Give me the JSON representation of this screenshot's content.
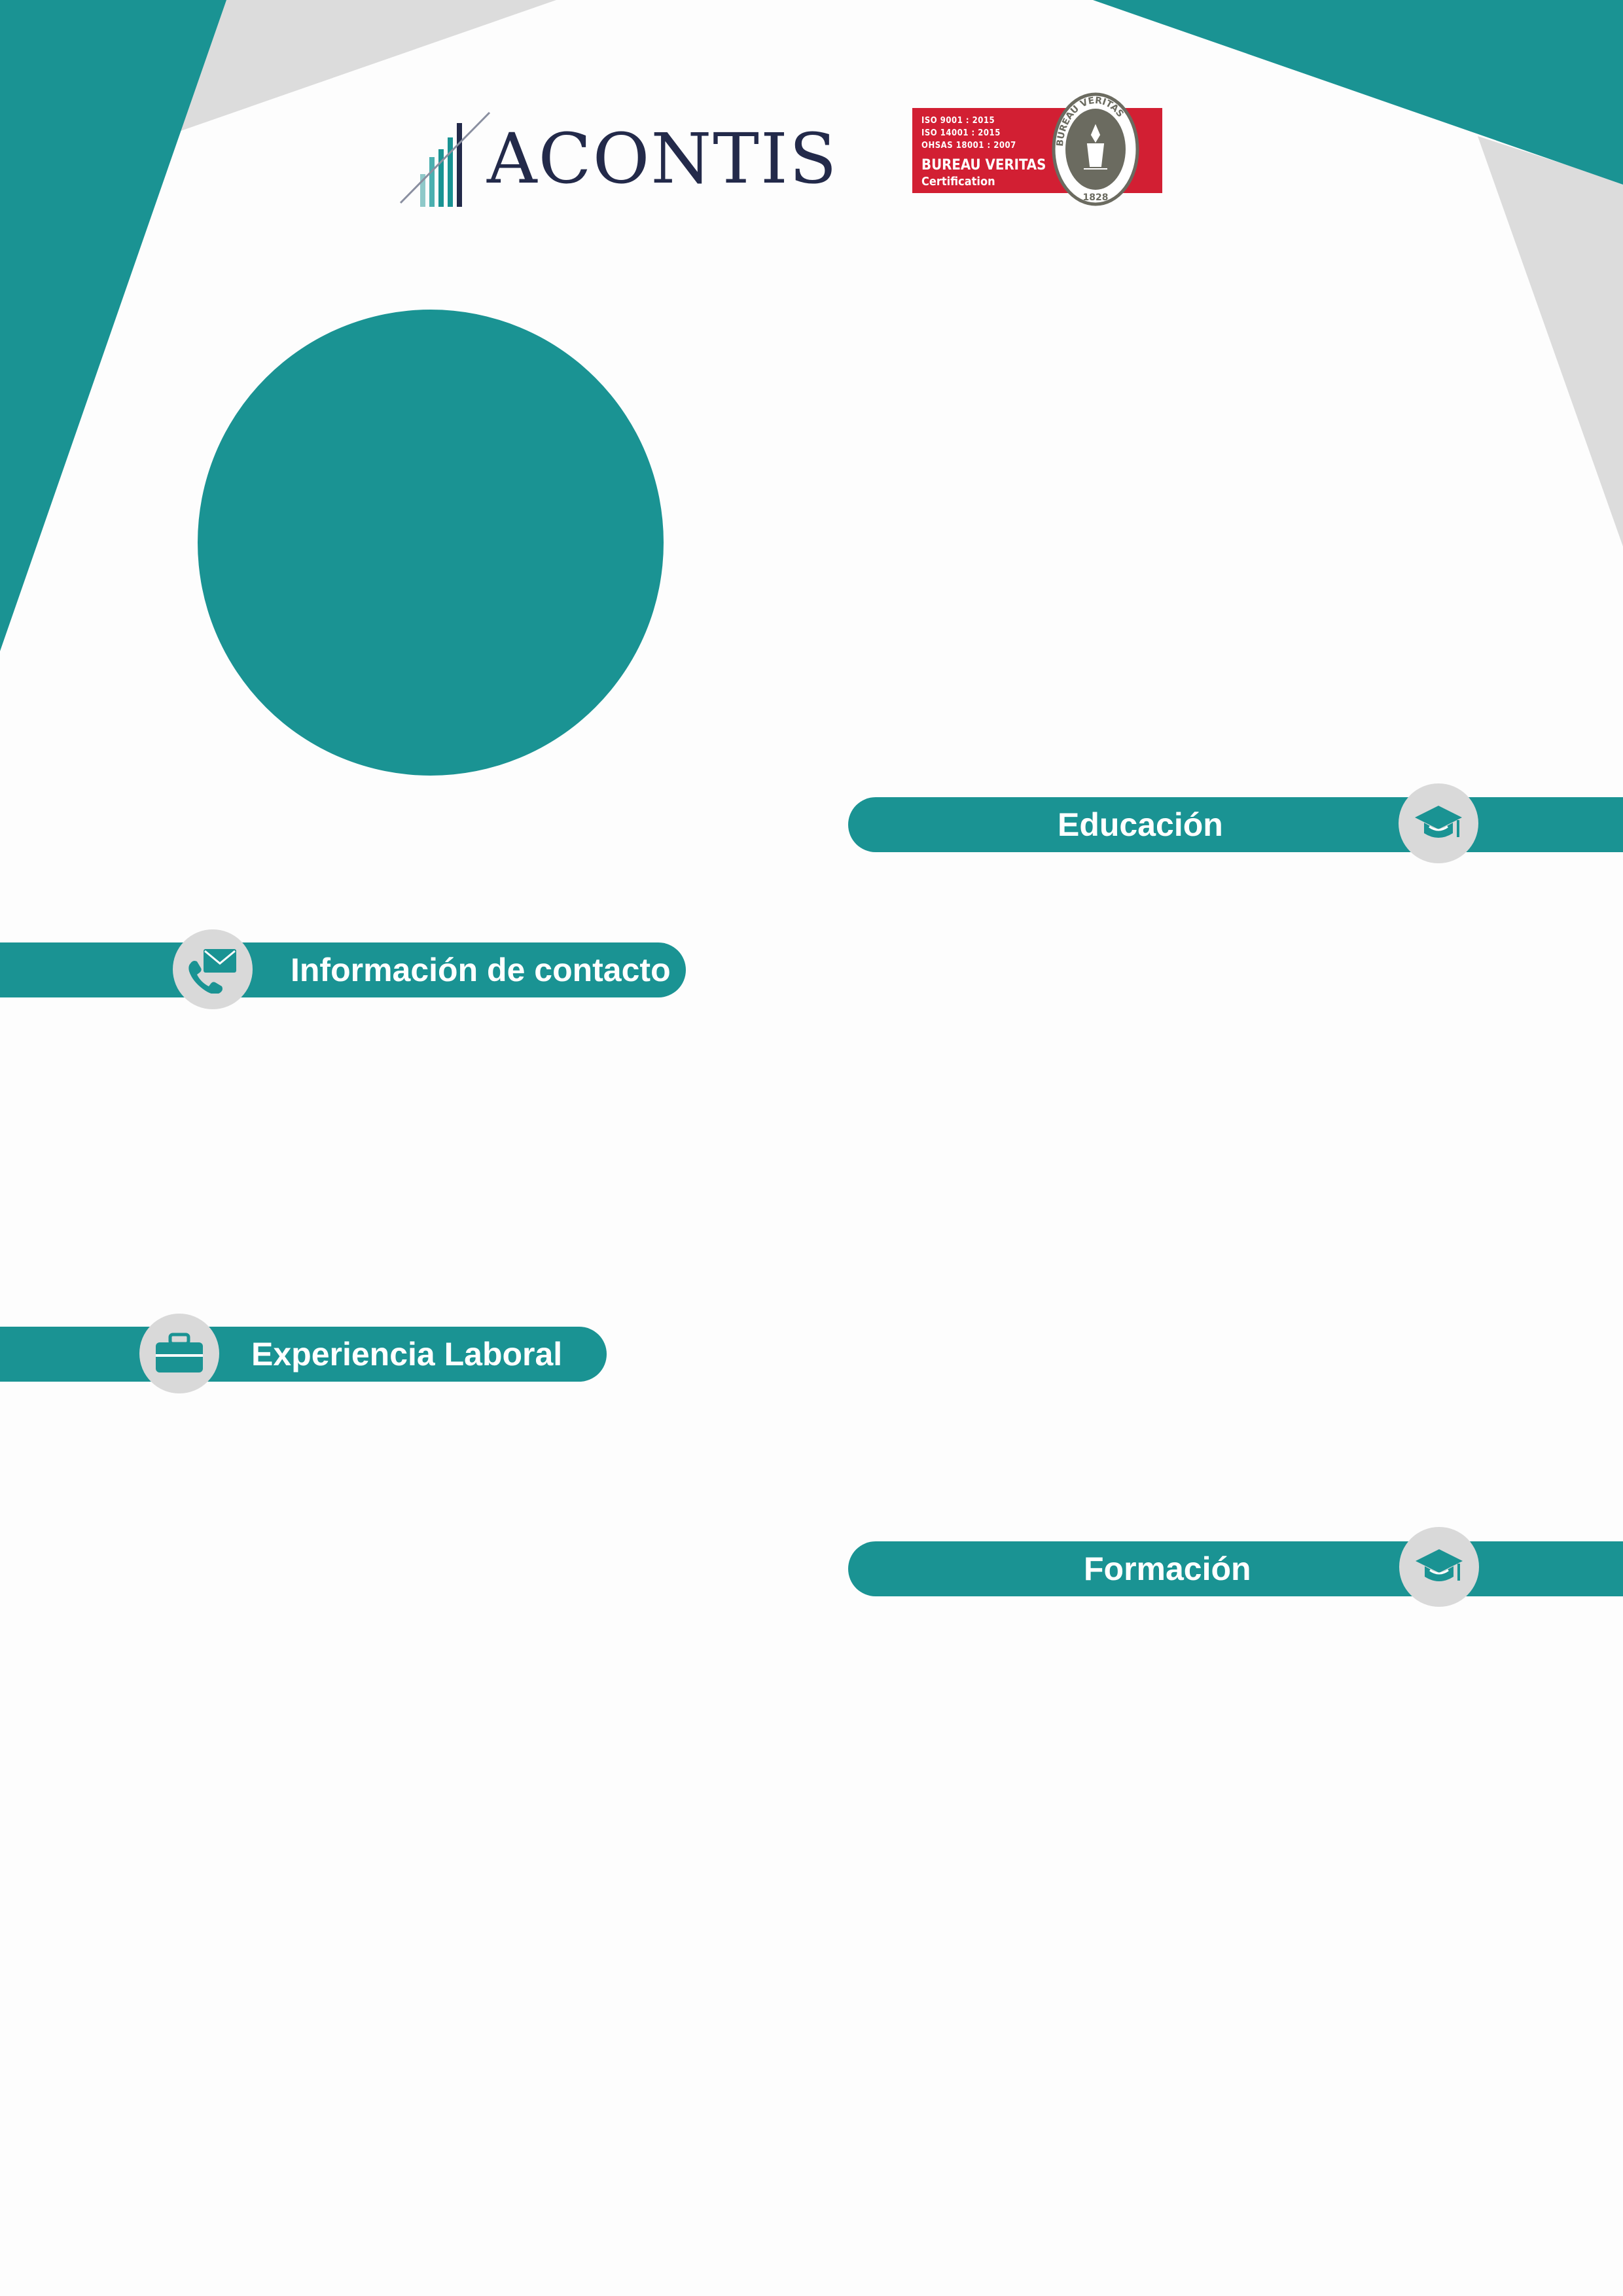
{
  "brand": {
    "name": "ACONTIS",
    "colors": {
      "teal": "#1a9393",
      "grey": "#dcdcdc",
      "navy": "#232a4a",
      "red": "#d21f33",
      "white": "#ffffff"
    }
  },
  "certification": {
    "iso_lines": [
      "ISO 9001 : 2015",
      "ISO 14001 : 2015",
      "OHSAS 18001 : 2007"
    ],
    "name": "BUREAU VERITAS",
    "label": "Certification",
    "seal_ring_text": "BUREAU VERITAS",
    "seal_year": "1828"
  },
  "sections": {
    "educacion": {
      "title": "Educación",
      "icon": "graduation-cap-icon"
    },
    "contacto": {
      "title": "Información de contacto",
      "icon": "phone-envelope-icon"
    },
    "experiencia": {
      "title": "Experiencia Laboral",
      "icon": "briefcase-icon"
    },
    "formacion": {
      "title": "Formación",
      "icon": "graduation-cap-icon"
    }
  },
  "photo": {
    "icon": "profile-photo-placeholder"
  }
}
